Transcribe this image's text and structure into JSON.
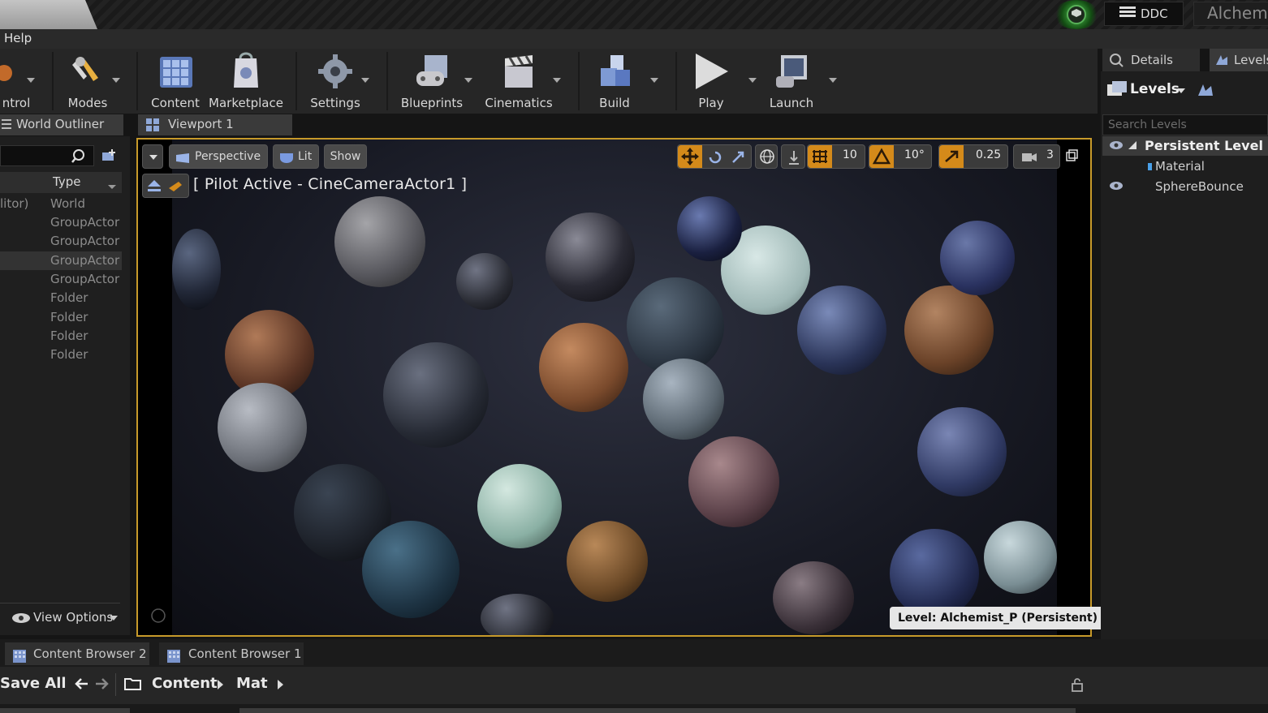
{
  "title_bar": {
    "ddc_label": "DDC",
    "project_name": "Alchemist",
    "source_control_icon": "source-control-icon"
  },
  "menu": {
    "help": "Help"
  },
  "toolbar": {
    "items": [
      {
        "label": "ntrol",
        "icon": "source-control-icon"
      },
      {
        "label": "Modes",
        "icon": "modes-icon"
      },
      {
        "label": "Content",
        "icon": "content-grid-icon"
      },
      {
        "label": "Marketplace",
        "icon": "marketplace-icon"
      },
      {
        "label": "Settings",
        "icon": "settings-gear-icon"
      },
      {
        "label": "Blueprints",
        "icon": "blueprints-icon"
      },
      {
        "label": "Cinematics",
        "icon": "clapperboard-icon"
      },
      {
        "label": "Build",
        "icon": "build-cubes-icon"
      },
      {
        "label": "Play",
        "icon": "play-icon"
      },
      {
        "label": "Launch",
        "icon": "launch-monitor-icon"
      }
    ]
  },
  "outliner": {
    "tab": "World Outliner",
    "type_header": "Type",
    "rows": [
      {
        "name": "litor)",
        "type": "World"
      },
      {
        "name": "",
        "type": "GroupActor"
      },
      {
        "name": "",
        "type": "GroupActor"
      },
      {
        "name": "",
        "type": "GroupActor"
      },
      {
        "name": "",
        "type": "GroupActor"
      },
      {
        "name": "",
        "type": "Folder"
      },
      {
        "name": "",
        "type": "Folder"
      },
      {
        "name": "",
        "type": "Folder"
      },
      {
        "name": "",
        "type": "Folder"
      }
    ],
    "view_options": "View Options"
  },
  "viewport": {
    "tab": "Viewport 1",
    "perspective": "Perspective",
    "lit": "Lit",
    "show": "Show",
    "pilot_label": "[ Pilot Active - CineCameraActor1 ]",
    "grid_snap": "10",
    "rotation_snap": "10°",
    "scale_snap": "0.25",
    "camera_speed": "3",
    "level_badge": "Level:  Alchemist_P (Persistent)"
  },
  "right_panel": {
    "details_tab": "Details",
    "levels_tab": "Levels",
    "levels_dropdown": "Levels",
    "search_placeholder": "Search Levels",
    "levels": [
      {
        "name": "Persistent Level"
      },
      {
        "name": "Material"
      },
      {
        "name": "SphereBounce"
      }
    ]
  },
  "content_browser": {
    "tabs": [
      "Content Browser 2",
      "Content Browser 1"
    ],
    "save_all": "Save All",
    "path": [
      "Content",
      "Mat"
    ]
  },
  "colors": {
    "accent_orange": "#d48a1a",
    "viewport_border": "#c79a2a",
    "source_control_green": "#2a7a2a"
  }
}
